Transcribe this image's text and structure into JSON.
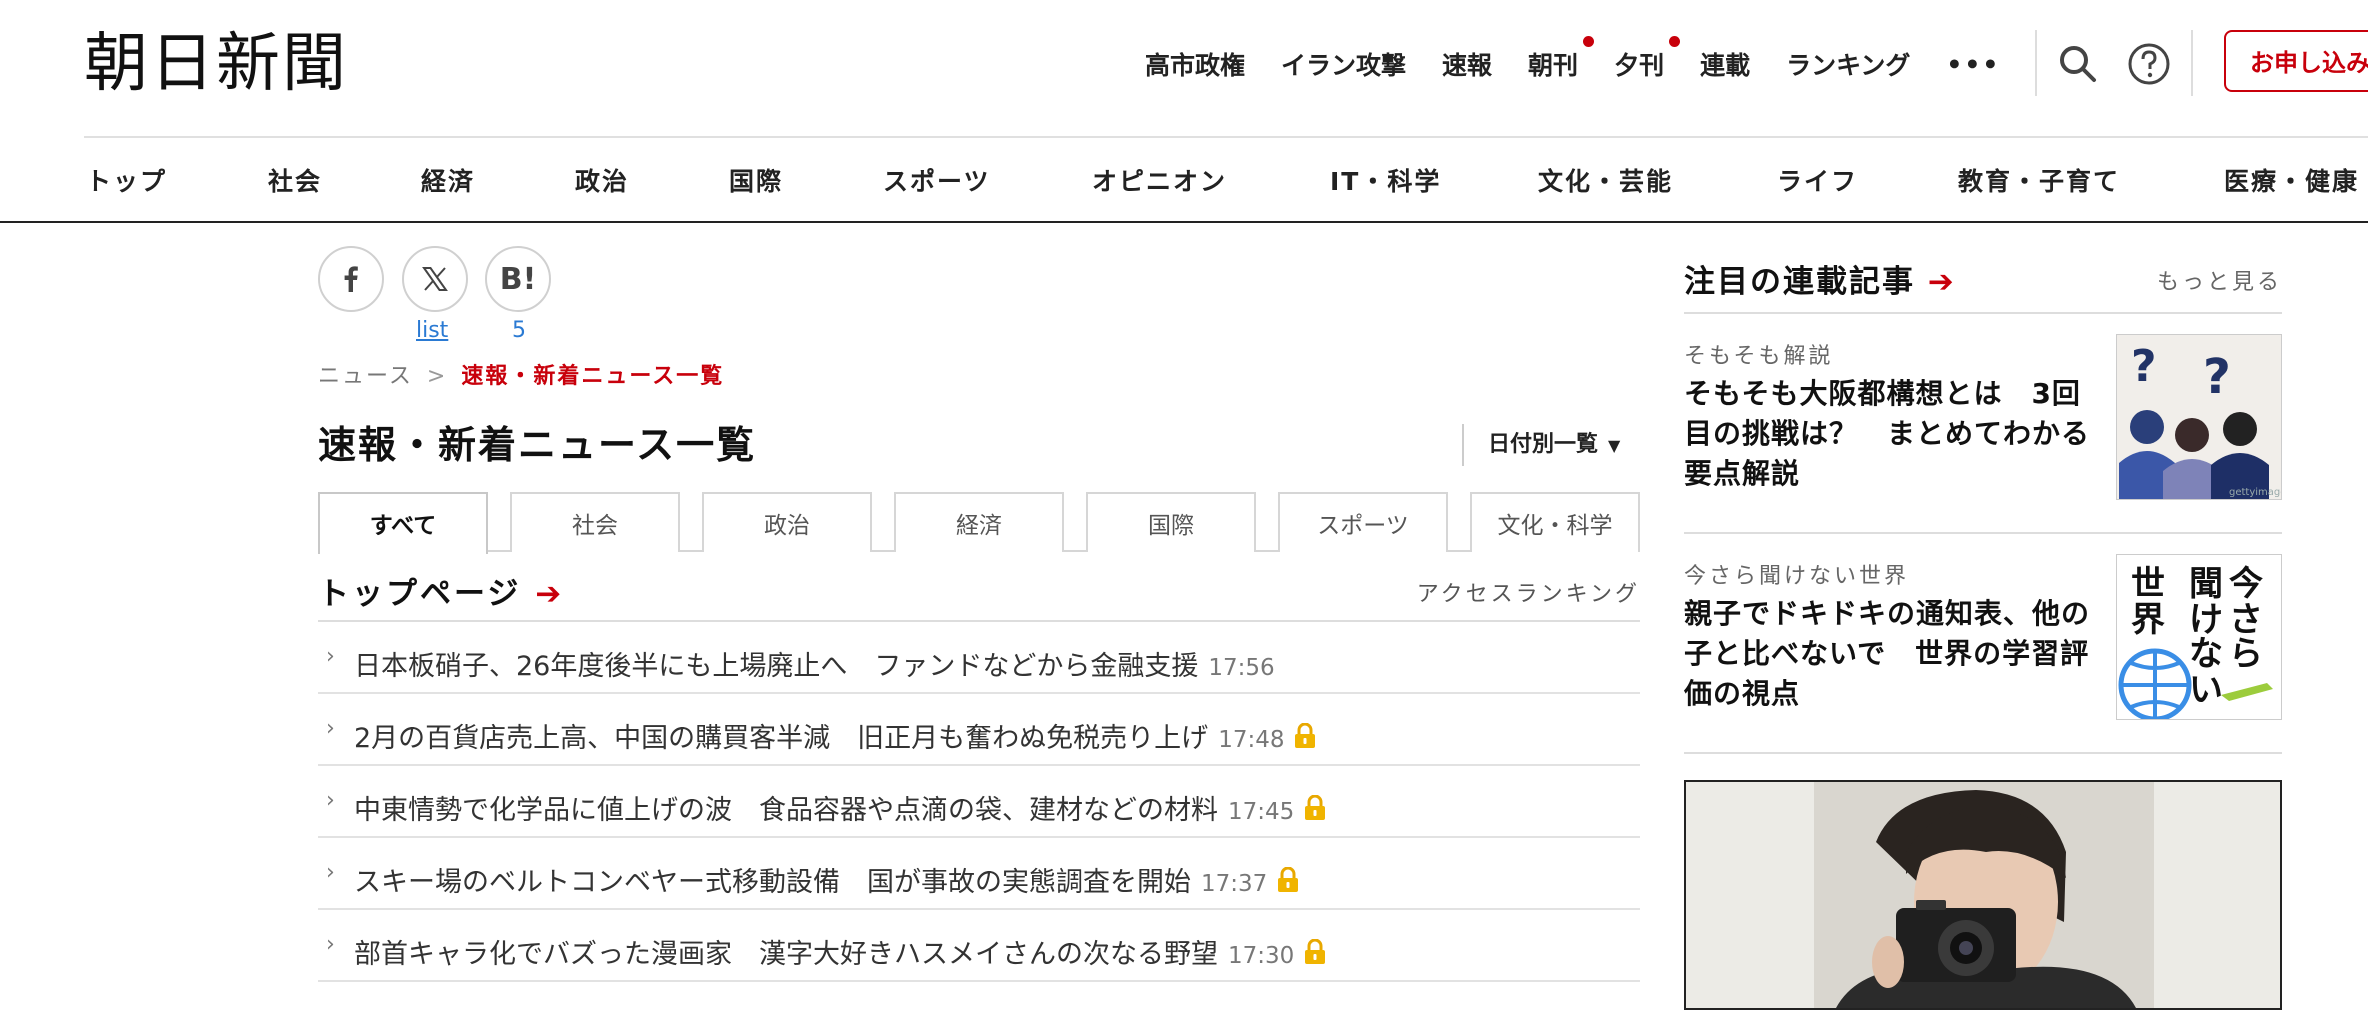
{
  "header": {
    "logo": "朝日新聞",
    "nav": [
      {
        "label": "高市政権",
        "dot": false
      },
      {
        "label": "イラン攻撃",
        "dot": false
      },
      {
        "label": "速報",
        "dot": false
      },
      {
        "label": "朝刊",
        "dot": true
      },
      {
        "label": "夕刊",
        "dot": true
      },
      {
        "label": "連載",
        "dot": false
      },
      {
        "label": "ランキング",
        "dot": false
      }
    ],
    "more_label": "•••",
    "cta_label": "お申し込み",
    "accent_color": "#c8000b"
  },
  "categories": [
    "トップ",
    "社会",
    "経済",
    "政治",
    "国際",
    "スポーツ",
    "オピニオン",
    "IT・科学",
    "文化・芸能",
    "ライフ",
    "教育・子育て",
    "医療・健康"
  ],
  "share": {
    "x_count": "list",
    "hatena_count": "5"
  },
  "breadcrumb": {
    "root": "ニュース",
    "separator": ">",
    "current": "速報・新着ニュース一覧"
  },
  "page": {
    "title": "速報・新着ニュース一覧",
    "date_list_label": "日付別一覧"
  },
  "tabs": [
    "すべて",
    "社会",
    "政治",
    "経済",
    "国際",
    "スポーツ",
    "文化・科学"
  ],
  "section": {
    "title": "トップページ",
    "ranking_label": "アクセスランキング"
  },
  "news": [
    {
      "title": "日本板硝子、26年度後半にも上場廃止へ　ファンドなどから金融支援",
      "time": "17:56",
      "locked": false
    },
    {
      "title": "2月の百貨店売上高、中国の購買客半減　旧正月も奮わぬ免税売り上げ",
      "time": "17:48",
      "locked": true
    },
    {
      "title": "中東情勢で化学品に値上げの波　食品容器や点滴の袋、建材などの材料",
      "time": "17:45",
      "locked": true
    },
    {
      "title": "スキー場のベルトコンベヤー式移動設備　国が事故の実態調査を開始",
      "time": "17:37",
      "locked": true
    },
    {
      "title": "部首キャラ化でバズった漫画家　漢字大好きハスメイさんの次なる野望",
      "time": "17:30",
      "locked": true
    }
  ],
  "sidebar": {
    "title": "注目の連載記事",
    "more_label": "もっと見る",
    "cards": [
      {
        "series": "そもそも解説",
        "headline": "そもそも大阪都構想とは　3回目の挑戦は？　まとめてわかる要点解説",
        "thumb_credit": "gettyimages"
      },
      {
        "series": "今さら聞けない世界",
        "headline": "親子でドキドキの通知表、他の子と比べないで　世界の学習評価の視点",
        "thumb_text": "今さら聞けない世界"
      }
    ]
  }
}
